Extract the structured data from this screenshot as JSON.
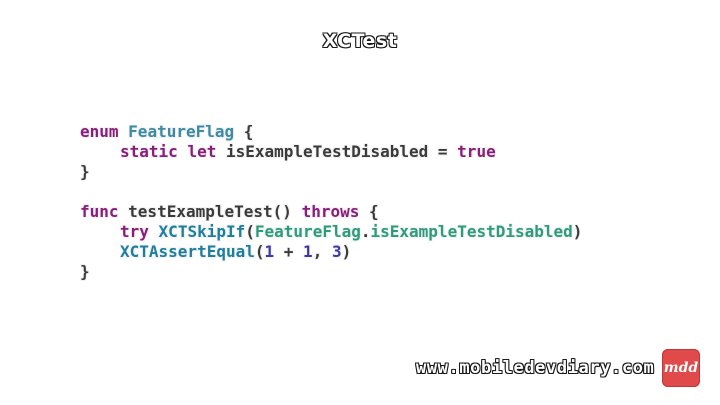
{
  "title": "XCTest",
  "code": {
    "lines": [
      {
        "id": "l1",
        "indent": 0,
        "tokens": [
          [
            "kw",
            "enum"
          ],
          [
            "pl",
            " "
          ],
          [
            "ty",
            "FeatureFlag"
          ],
          [
            "pl",
            " {"
          ]
        ]
      },
      {
        "id": "l2",
        "indent": 1,
        "tokens": [
          [
            "kw",
            "static"
          ],
          [
            "pl",
            " "
          ],
          [
            "kw",
            "let"
          ],
          [
            "pl",
            " isExampleTestDisabled = "
          ],
          [
            "kw",
            "true"
          ]
        ]
      },
      {
        "id": "l3",
        "indent": 0,
        "tokens": [
          [
            "pl",
            "}"
          ]
        ]
      },
      {
        "id": "l4",
        "indent": 0,
        "tokens": []
      },
      {
        "id": "l5",
        "indent": 0,
        "tokens": [
          [
            "kw",
            "func"
          ],
          [
            "pl",
            " testExampleTest() "
          ],
          [
            "kw",
            "throws"
          ],
          [
            "pl",
            " {"
          ]
        ]
      },
      {
        "id": "l6",
        "indent": 1,
        "tokens": [
          [
            "kw",
            "try"
          ],
          [
            "pl",
            " "
          ],
          [
            "fn",
            "XCTSkipIf"
          ],
          [
            "pl",
            "("
          ],
          [
            "sy",
            "FeatureFlag"
          ],
          [
            "pl",
            "."
          ],
          [
            "sy",
            "isExampleTestDisabled"
          ],
          [
            "pl",
            ")"
          ]
        ]
      },
      {
        "id": "l7",
        "indent": 1,
        "tokens": [
          [
            "fn",
            "XCTAssertEqual"
          ],
          [
            "pl",
            "("
          ],
          [
            "nu",
            "1"
          ],
          [
            "pl",
            " + "
          ],
          [
            "nu",
            "1"
          ],
          [
            "pl",
            ", "
          ],
          [
            "nu",
            "3"
          ],
          [
            "pl",
            ")"
          ]
        ]
      },
      {
        "id": "l8",
        "indent": 0,
        "tokens": [
          [
            "pl",
            "}"
          ]
        ]
      }
    ]
  },
  "footer": {
    "url": "www.mobiledevdiary.com",
    "logo_text": "mdd"
  },
  "colors": {
    "keyword": "#8a1d7c",
    "type": "#3c8aa6",
    "function": "#1c7fa0",
    "symbol": "#2c9c7c",
    "number": "#3d3aa8",
    "plain": "#3a3a3a",
    "logo_bg": "#e04a4a"
  }
}
